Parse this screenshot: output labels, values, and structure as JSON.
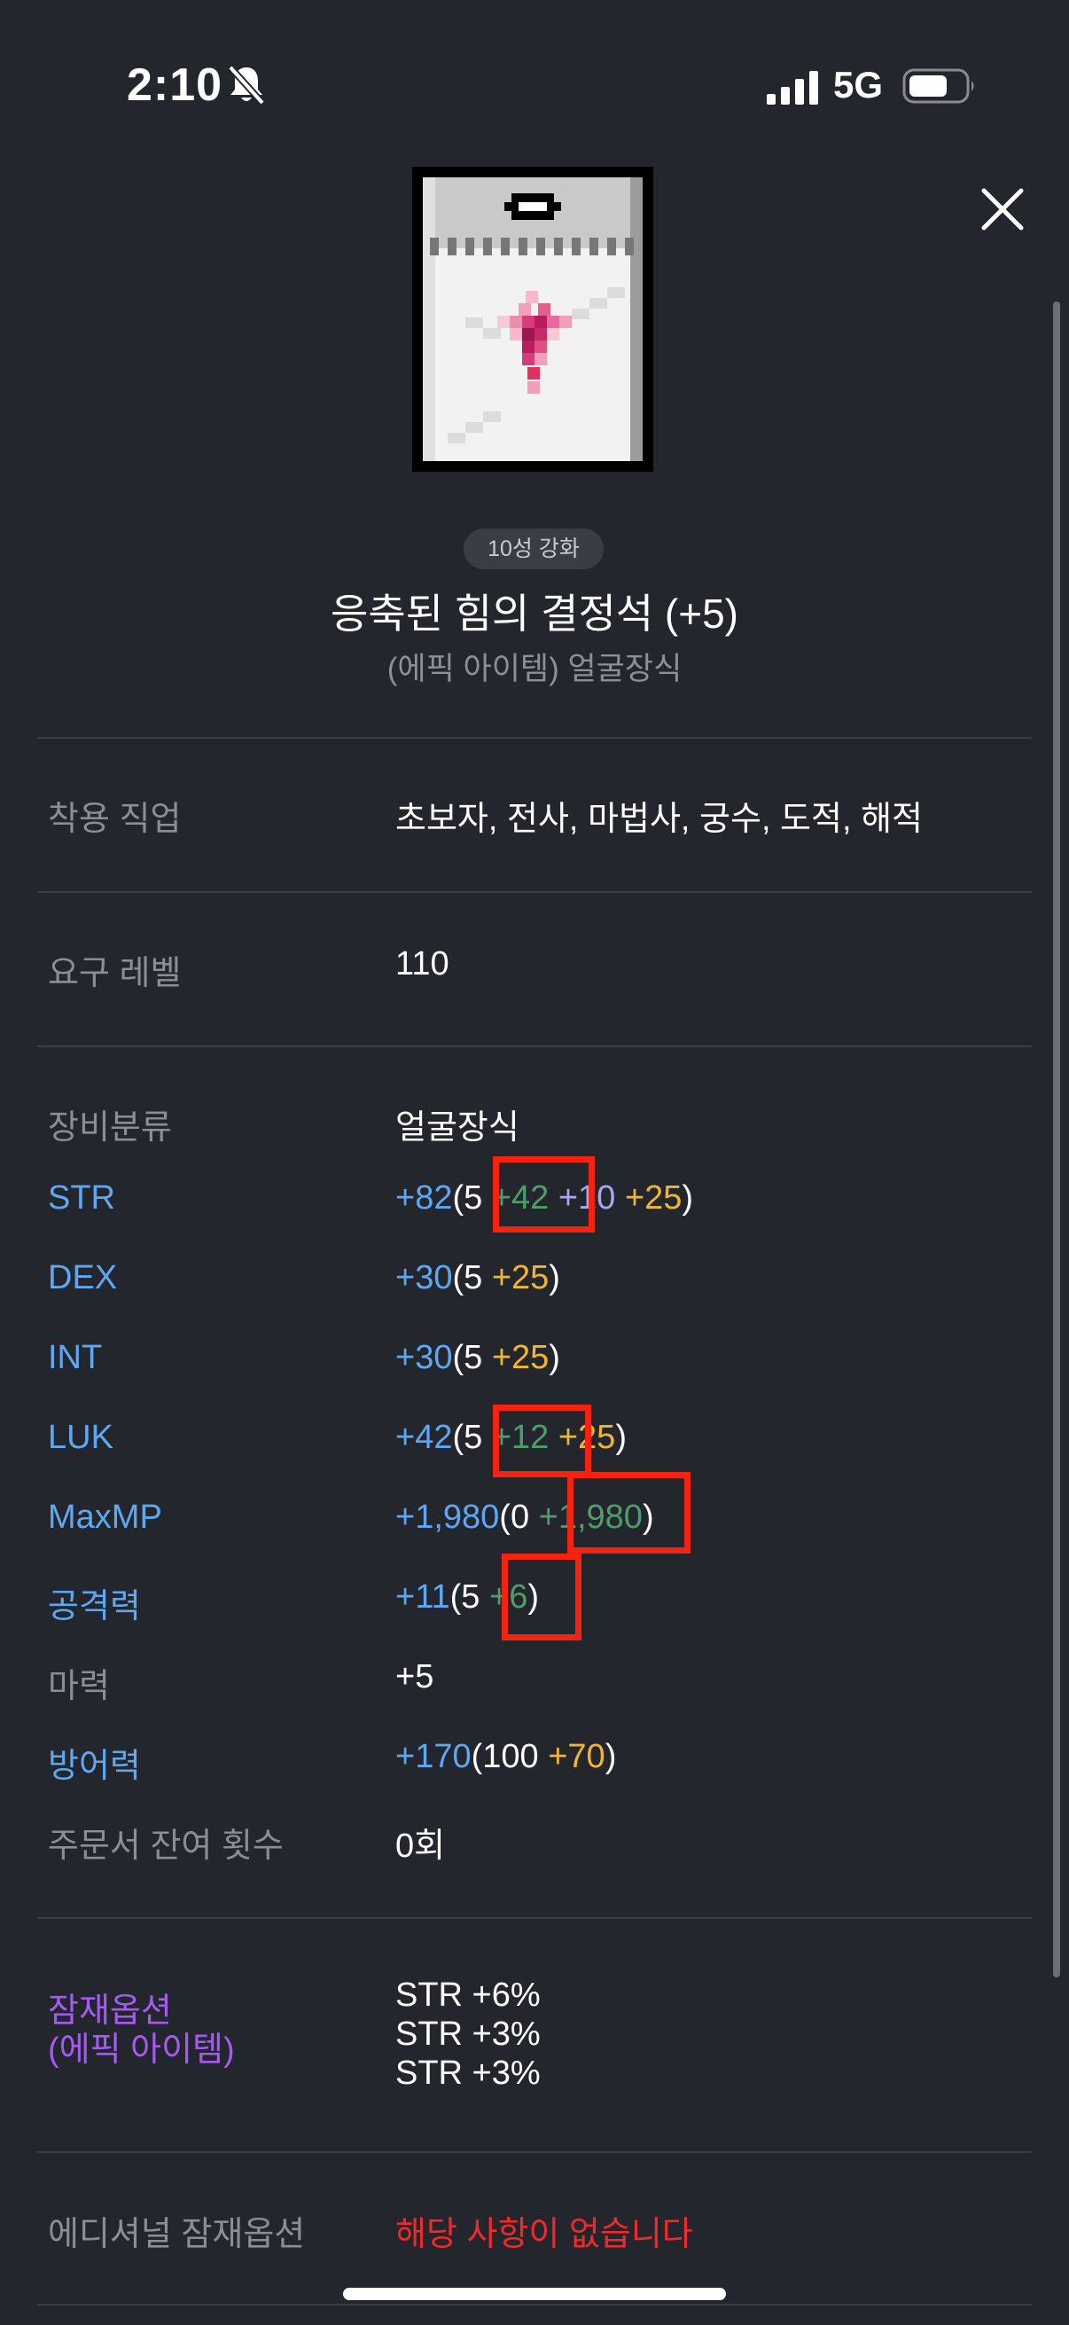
{
  "status": {
    "time": "2:10",
    "network": "5G"
  },
  "badge": "10성 강화",
  "item": {
    "name": "응축된 힘의 결정석 (+5)",
    "subtitle": "(에픽 아이템) 얼굴장식"
  },
  "rows": {
    "job": {
      "label": "착용 직업",
      "value": "초보자, 전사, 마법사, 궁수, 도적, 해적"
    },
    "level": {
      "label": "요구 레벨",
      "value": "110"
    },
    "category": {
      "label": "장비분류",
      "value": "얼굴장식"
    },
    "str": {
      "label": "STR",
      "total": "+82",
      "open": "(5",
      "a": "+42",
      "b": "+10",
      "c": "+25",
      "close": ")"
    },
    "dex": {
      "label": "DEX",
      "total": "+30",
      "open": "(5",
      "c": "+25",
      "close": ")"
    },
    "int": {
      "label": "INT",
      "total": "+30",
      "open": "(5",
      "c": "+25",
      "close": ")"
    },
    "luk": {
      "label": "LUK",
      "total": "+42",
      "open": "(5",
      "a": "+12",
      "c": "+25",
      "close": ")"
    },
    "maxmp": {
      "label": "MaxMP",
      "total": "+1,980",
      "open": "(0",
      "a": "+1,980",
      "close": ")"
    },
    "atk": {
      "label": "공격력",
      "total": "+11",
      "open": "(5",
      "a": "+6",
      "close": ")"
    },
    "magic": {
      "label": "마력",
      "value": "+5"
    },
    "def": {
      "label": "방어력",
      "total": "+170",
      "open": "(100",
      "c": "+70",
      "close": ")"
    },
    "scroll": {
      "label": "주문서 잔여 횟수",
      "value": "0회"
    }
  },
  "potential": {
    "label_line1": "잠재옵션",
    "label_line2": "(에픽 아이템)",
    "lines": [
      "STR +6%",
      "STR +3%",
      "STR +3%"
    ]
  },
  "additional": {
    "label": "에디셔널 잠재옵션",
    "value": "해당 사항이 없습니다"
  }
}
